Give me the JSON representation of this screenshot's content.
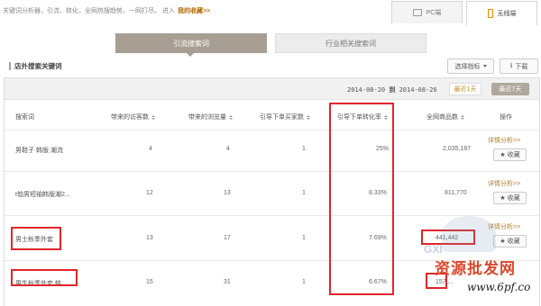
{
  "intro": {
    "text": "关键词分析器，引流、转化，全网热搜趋势，一网打尽。 进入",
    "link": "我的收藏>>"
  },
  "device_tabs": [
    {
      "label": "PC端",
      "icon": "monitor-icon"
    },
    {
      "label": "无线端",
      "icon": "phone-icon"
    }
  ],
  "segments": [
    {
      "label": "引流搜索词",
      "active": true
    },
    {
      "label": "行业相关搜索词",
      "active": false
    }
  ],
  "section": {
    "title": "店外搜索关键词",
    "select_label": "选择指标",
    "download_label": "下载"
  },
  "date": {
    "start": "2014-08-20",
    "sep": "到",
    "end": "2014-08-26"
  },
  "ranges": {
    "day1": "最近1天",
    "day7": "最近7天"
  },
  "columns": [
    "搜索词",
    "带来的访客数",
    "带来的浏览量",
    "引导下单买家数",
    "引导下单转化率",
    "全网商品数",
    "操作"
  ],
  "rows": [
    {
      "kw": "男鞋子 韩版 潮流",
      "visitors": "4",
      "views": "4",
      "buyers": "1",
      "rate": "25%",
      "items": "2,035,187",
      "detail": "详情分析>>",
      "fav": "收藏"
    },
    {
      "kw": "t恤男短袖韩版潮2...",
      "visitors": "12",
      "views": "13",
      "buyers": "1",
      "rate": "8.33%",
      "items": "811,770",
      "detail": "详情分析>>",
      "fav": "收藏"
    },
    {
      "kw": "男士秋季外套",
      "visitors": "13",
      "views": "17",
      "buyers": "1",
      "rate": "7.69%",
      "items": "441,442",
      "detail": "详情分析>>",
      "fav": "收藏"
    },
    {
      "kw": "男生秋季外套 韩...",
      "visitors": "15",
      "views": "31",
      "buyers": "1",
      "rate": "6.67%",
      "items": "157,...",
      "detail": "",
      "fav": ""
    }
  ],
  "watermark": {
    "big": "资源批发网",
    "small": "www.6pf.co",
    "faint": "GXI"
  },
  "colors": {
    "accent": "#a89f94",
    "highlight": "#e0262a",
    "link": "#b07a2a"
  }
}
